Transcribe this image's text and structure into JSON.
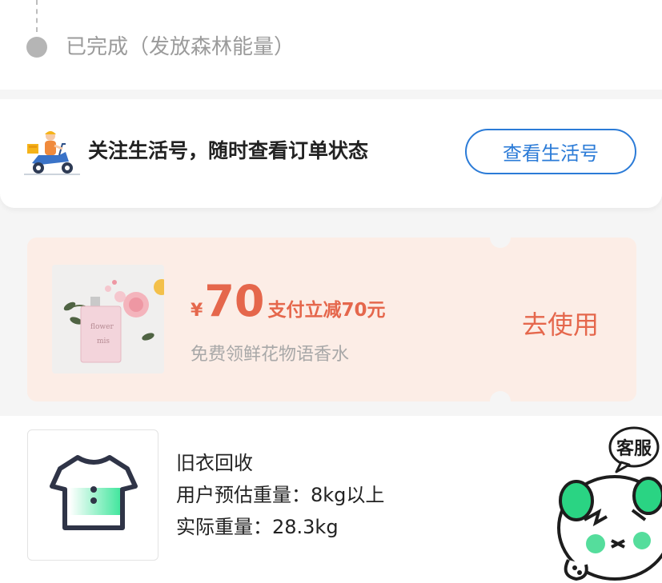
{
  "timeline": {
    "last_step_label": "已完成（发放森林能量）"
  },
  "follow_card": {
    "text": "关注生活号，随时查看订单状态",
    "button_label": "查看生活号",
    "icon": "delivery-scooter-icon"
  },
  "coupon": {
    "currency": "¥",
    "amount": "70",
    "title": "支付立减70元",
    "subtitle": "免费领鲜花物语香水",
    "use_label": "去使用",
    "image": "perfume-flower-image",
    "accent_color": "#e5674c",
    "background_color": "#fcede6"
  },
  "recycle": {
    "icon": "tshirt-icon",
    "title": "旧衣回收",
    "estimated_weight": "用户预估重量：8kg以上",
    "actual_weight": "实际重量：28.3kg"
  },
  "customer_service": {
    "label": "客服",
    "icon": "panda-mascot-icon"
  }
}
